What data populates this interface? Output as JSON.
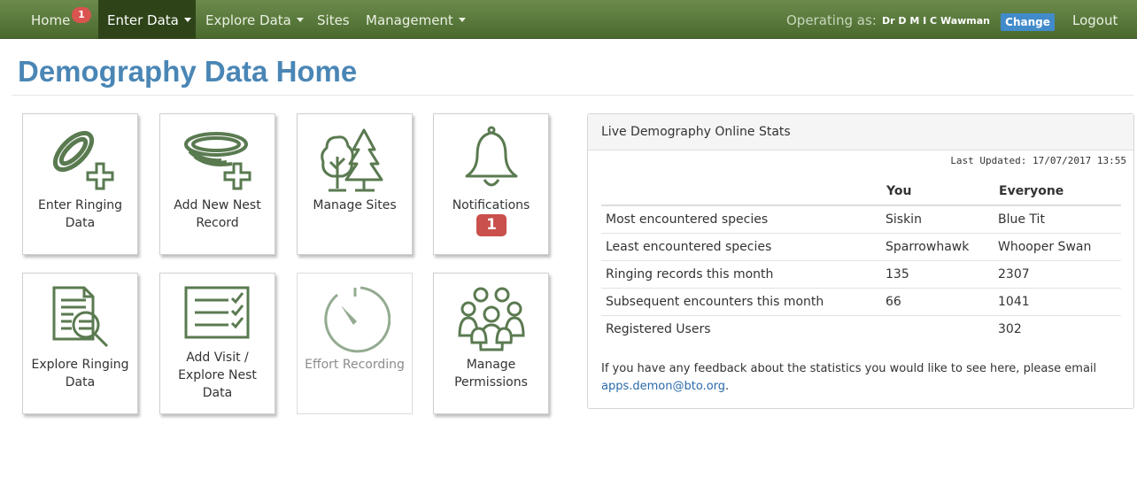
{
  "nav": {
    "home": "Home",
    "home_badge": "1",
    "enter_data": "Enter Data",
    "explore_data": "Explore Data",
    "sites": "Sites",
    "management": "Management",
    "operating_as": "Operating as:",
    "user": "Dr D M I C Wawman",
    "change": "Change",
    "logout": "Logout"
  },
  "page_title": "Demography Data Home",
  "tiles": [
    {
      "label": "Enter Ringing Data",
      "icon": "ring-plus-icon"
    },
    {
      "label": "Add New Nest Record",
      "icon": "nest-plus-icon"
    },
    {
      "label": "Manage Sites",
      "icon": "trees-icon"
    },
    {
      "label": "Notifications",
      "icon": "bell-icon",
      "badge": "1"
    },
    {
      "label": "Explore Ringing Data",
      "icon": "document-search-icon"
    },
    {
      "label": "Add Visit / Explore Nest Data",
      "icon": "checklist-icon"
    },
    {
      "label": "Effort Recording",
      "icon": "gauge-icon",
      "disabled": true
    },
    {
      "label": "Manage Permissions",
      "icon": "people-group-icon"
    }
  ],
  "stats": {
    "heading": "Live Demography Online Stats",
    "last_updated": "Last Updated: 17/07/2017 13:55",
    "columns": [
      "",
      "You",
      "Everyone"
    ],
    "rows": [
      [
        "Most encountered species",
        "Siskin",
        "Blue Tit"
      ],
      [
        "Least encountered species",
        "Sparrowhawk",
        "Whooper Swan"
      ],
      [
        "Ringing records this month",
        "135",
        "2307"
      ],
      [
        "Subsequent encounters this month",
        "66",
        "1041"
      ],
      [
        "Registered Users",
        "",
        "302"
      ]
    ],
    "feedback_text": "If you have any feedback about the statistics you would like to see here, please email",
    "feedback_email": "apps.demon@bto.org"
  },
  "colors": {
    "nav_green": "#5a7a3c",
    "icon_green": "#5a7a50",
    "title_blue": "#4a86b5",
    "badge_red": "#c9504c",
    "change_blue": "#428bca"
  }
}
